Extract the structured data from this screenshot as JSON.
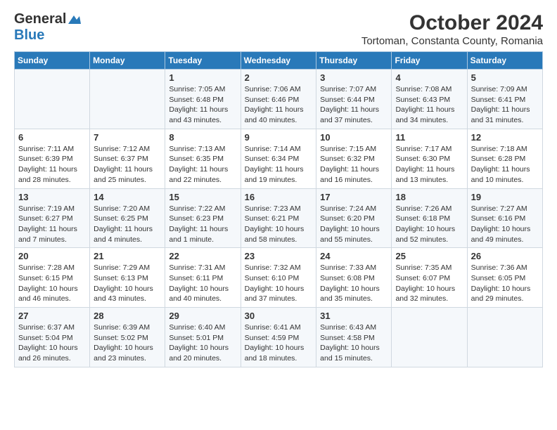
{
  "header": {
    "logo_general": "General",
    "logo_blue": "Blue",
    "title": "October 2024",
    "subtitle": "Tortoman, Constanta County, Romania"
  },
  "calendar": {
    "days_of_week": [
      "Sunday",
      "Monday",
      "Tuesday",
      "Wednesday",
      "Thursday",
      "Friday",
      "Saturday"
    ],
    "weeks": [
      [
        {
          "day": "",
          "info": ""
        },
        {
          "day": "",
          "info": ""
        },
        {
          "day": "1",
          "info": "Sunrise: 7:05 AM\nSunset: 6:48 PM\nDaylight: 11 hours and 43 minutes."
        },
        {
          "day": "2",
          "info": "Sunrise: 7:06 AM\nSunset: 6:46 PM\nDaylight: 11 hours and 40 minutes."
        },
        {
          "day": "3",
          "info": "Sunrise: 7:07 AM\nSunset: 6:44 PM\nDaylight: 11 hours and 37 minutes."
        },
        {
          "day": "4",
          "info": "Sunrise: 7:08 AM\nSunset: 6:43 PM\nDaylight: 11 hours and 34 minutes."
        },
        {
          "day": "5",
          "info": "Sunrise: 7:09 AM\nSunset: 6:41 PM\nDaylight: 11 hours and 31 minutes."
        }
      ],
      [
        {
          "day": "6",
          "info": "Sunrise: 7:11 AM\nSunset: 6:39 PM\nDaylight: 11 hours and 28 minutes."
        },
        {
          "day": "7",
          "info": "Sunrise: 7:12 AM\nSunset: 6:37 PM\nDaylight: 11 hours and 25 minutes."
        },
        {
          "day": "8",
          "info": "Sunrise: 7:13 AM\nSunset: 6:35 PM\nDaylight: 11 hours and 22 minutes."
        },
        {
          "day": "9",
          "info": "Sunrise: 7:14 AM\nSunset: 6:34 PM\nDaylight: 11 hours and 19 minutes."
        },
        {
          "day": "10",
          "info": "Sunrise: 7:15 AM\nSunset: 6:32 PM\nDaylight: 11 hours and 16 minutes."
        },
        {
          "day": "11",
          "info": "Sunrise: 7:17 AM\nSunset: 6:30 PM\nDaylight: 11 hours and 13 minutes."
        },
        {
          "day": "12",
          "info": "Sunrise: 7:18 AM\nSunset: 6:28 PM\nDaylight: 11 hours and 10 minutes."
        }
      ],
      [
        {
          "day": "13",
          "info": "Sunrise: 7:19 AM\nSunset: 6:27 PM\nDaylight: 11 hours and 7 minutes."
        },
        {
          "day": "14",
          "info": "Sunrise: 7:20 AM\nSunset: 6:25 PM\nDaylight: 11 hours and 4 minutes."
        },
        {
          "day": "15",
          "info": "Sunrise: 7:22 AM\nSunset: 6:23 PM\nDaylight: 11 hours and 1 minute."
        },
        {
          "day": "16",
          "info": "Sunrise: 7:23 AM\nSunset: 6:21 PM\nDaylight: 10 hours and 58 minutes."
        },
        {
          "day": "17",
          "info": "Sunrise: 7:24 AM\nSunset: 6:20 PM\nDaylight: 10 hours and 55 minutes."
        },
        {
          "day": "18",
          "info": "Sunrise: 7:26 AM\nSunset: 6:18 PM\nDaylight: 10 hours and 52 minutes."
        },
        {
          "day": "19",
          "info": "Sunrise: 7:27 AM\nSunset: 6:16 PM\nDaylight: 10 hours and 49 minutes."
        }
      ],
      [
        {
          "day": "20",
          "info": "Sunrise: 7:28 AM\nSunset: 6:15 PM\nDaylight: 10 hours and 46 minutes."
        },
        {
          "day": "21",
          "info": "Sunrise: 7:29 AM\nSunset: 6:13 PM\nDaylight: 10 hours and 43 minutes."
        },
        {
          "day": "22",
          "info": "Sunrise: 7:31 AM\nSunset: 6:11 PM\nDaylight: 10 hours and 40 minutes."
        },
        {
          "day": "23",
          "info": "Sunrise: 7:32 AM\nSunset: 6:10 PM\nDaylight: 10 hours and 37 minutes."
        },
        {
          "day": "24",
          "info": "Sunrise: 7:33 AM\nSunset: 6:08 PM\nDaylight: 10 hours and 35 minutes."
        },
        {
          "day": "25",
          "info": "Sunrise: 7:35 AM\nSunset: 6:07 PM\nDaylight: 10 hours and 32 minutes."
        },
        {
          "day": "26",
          "info": "Sunrise: 7:36 AM\nSunset: 6:05 PM\nDaylight: 10 hours and 29 minutes."
        }
      ],
      [
        {
          "day": "27",
          "info": "Sunrise: 6:37 AM\nSunset: 5:04 PM\nDaylight: 10 hours and 26 minutes."
        },
        {
          "day": "28",
          "info": "Sunrise: 6:39 AM\nSunset: 5:02 PM\nDaylight: 10 hours and 23 minutes."
        },
        {
          "day": "29",
          "info": "Sunrise: 6:40 AM\nSunset: 5:01 PM\nDaylight: 10 hours and 20 minutes."
        },
        {
          "day": "30",
          "info": "Sunrise: 6:41 AM\nSunset: 4:59 PM\nDaylight: 10 hours and 18 minutes."
        },
        {
          "day": "31",
          "info": "Sunrise: 6:43 AM\nSunset: 4:58 PM\nDaylight: 10 hours and 15 minutes."
        },
        {
          "day": "",
          "info": ""
        },
        {
          "day": "",
          "info": ""
        }
      ]
    ]
  }
}
